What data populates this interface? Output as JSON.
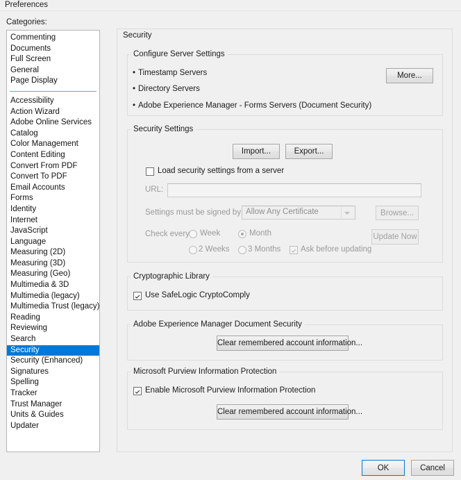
{
  "window": {
    "title": "Preferences"
  },
  "sidebar": {
    "label": "Categories:",
    "top_items": [
      {
        "label": "Commenting"
      },
      {
        "label": "Documents"
      },
      {
        "label": "Full Screen"
      },
      {
        "label": "General"
      },
      {
        "label": "Page Display"
      }
    ],
    "items": [
      {
        "label": "Accessibility"
      },
      {
        "label": "Action Wizard"
      },
      {
        "label": "Adobe Online Services"
      },
      {
        "label": "Catalog"
      },
      {
        "label": "Color Management"
      },
      {
        "label": "Content Editing"
      },
      {
        "label": "Convert From PDF"
      },
      {
        "label": "Convert To PDF"
      },
      {
        "label": "Email Accounts"
      },
      {
        "label": "Forms"
      },
      {
        "label": "Identity"
      },
      {
        "label": "Internet"
      },
      {
        "label": "JavaScript"
      },
      {
        "label": "Language"
      },
      {
        "label": "Measuring (2D)"
      },
      {
        "label": "Measuring (3D)"
      },
      {
        "label": "Measuring (Geo)"
      },
      {
        "label": "Multimedia & 3D"
      },
      {
        "label": "Multimedia (legacy)"
      },
      {
        "label": "Multimedia Trust (legacy)"
      },
      {
        "label": "Reading"
      },
      {
        "label": "Reviewing"
      },
      {
        "label": "Search"
      },
      {
        "label": "Security",
        "selected": true
      },
      {
        "label": "Security (Enhanced)"
      },
      {
        "label": "Signatures"
      },
      {
        "label": "Spelling"
      },
      {
        "label": "Tracker"
      },
      {
        "label": "Trust Manager"
      },
      {
        "label": "Units & Guides"
      },
      {
        "label": "Updater"
      }
    ],
    "selected": "Security",
    "selection_color": "#0078d7"
  },
  "panel": {
    "title": "Security",
    "server_settings": {
      "title": "Configure Server Settings",
      "bullets": [
        "Timestamp Servers",
        "Directory Servers",
        "Adobe Experience Manager - Forms Servers (Document Security)"
      ],
      "more_button": "More..."
    },
    "security_settings": {
      "title": "Security Settings",
      "import_button": "Import...",
      "export_button": "Export...",
      "load_from_server_label": "Load security settings from a server",
      "load_from_server_checked": false,
      "url_label": "URL:",
      "url_value": "",
      "signed_by_label": "Settings must be signed by:",
      "signed_by_value": "Allow Any Certificate",
      "browse_button": "Browse...",
      "check_every_label": "Check every:",
      "frequency_options": [
        {
          "label": "Week",
          "selected": false
        },
        {
          "label": "Month",
          "selected": true
        },
        {
          "label": "2 Weeks",
          "selected": false
        },
        {
          "label": "3 Months",
          "selected": false
        }
      ],
      "ask_before_updating_label": "Ask before updating",
      "ask_before_updating_checked": true,
      "update_now_button": "Update Now"
    },
    "crypto_library": {
      "title": "Cryptographic Library",
      "use_safelogic_label": "Use SafeLogic CryptoComply",
      "use_safelogic_checked": true
    },
    "aem_document_security": {
      "title": "Adobe Experience Manager Document Security",
      "clear_button": "Clear remembered account information..."
    },
    "purview": {
      "title": "Microsoft Purview Information Protection",
      "enable_label": "Enable Microsoft Purview Information Protection",
      "enable_checked": true,
      "clear_button": "Clear remembered account information..."
    }
  },
  "footer": {
    "ok_button": "OK",
    "cancel_button": "Cancel"
  }
}
